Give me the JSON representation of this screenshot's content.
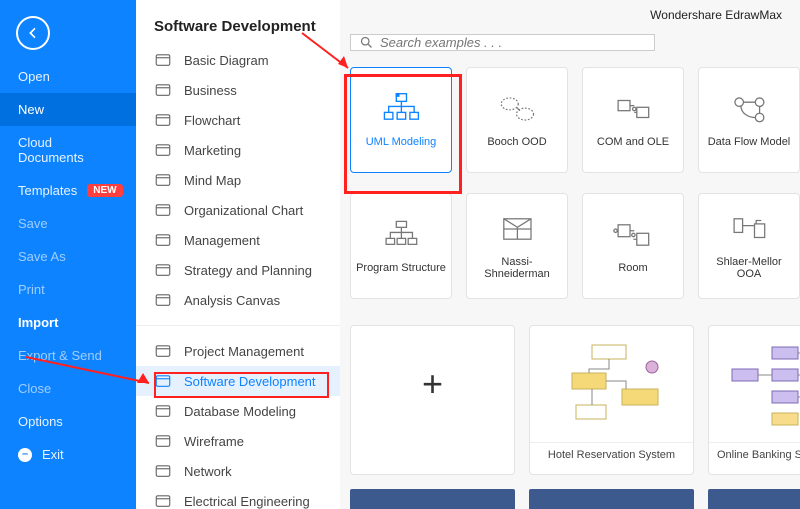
{
  "app_title": "Wondershare EdrawMax",
  "page_title": "Software Development",
  "new_badge": "NEW",
  "sidebar": [
    {
      "label": "Open",
      "kind": "item"
    },
    {
      "label": "New",
      "kind": "selected"
    },
    {
      "label": "Cloud Documents",
      "kind": "item"
    },
    {
      "label": "Templates",
      "kind": "new"
    },
    {
      "label": "Save",
      "kind": "muted"
    },
    {
      "label": "Save As",
      "kind": "muted"
    },
    {
      "label": "Print",
      "kind": "muted"
    },
    {
      "label": "Import",
      "kind": "bold"
    },
    {
      "label": "Export & Send",
      "kind": "muted"
    },
    {
      "label": "Close",
      "kind": "muted"
    },
    {
      "label": "Options",
      "kind": "item"
    },
    {
      "label": "Exit",
      "kind": "exit"
    }
  ],
  "categories_top": [
    "Basic Diagram",
    "Business",
    "Flowchart",
    "Marketing",
    "Mind Map",
    "Organizational Chart",
    "Management",
    "Strategy and Planning",
    "Analysis Canvas"
  ],
  "categories_bottom": [
    "Project Management",
    "Software Development",
    "Database Modeling",
    "Wireframe",
    "Network",
    "Electrical Engineering"
  ],
  "active_category": "Software Development",
  "search_placeholder": "Search examples . . .",
  "templates_row1": [
    "UML Modeling",
    "Booch OOD",
    "COM and OLE",
    "Data Flow Model"
  ],
  "templates_row2": [
    "Program Structure",
    "Nassi-Shneiderman",
    "Room",
    "Shlaer-Mellor OOA"
  ],
  "selected_template": "UML Modeling",
  "gallery": [
    "Hotel Reservation System",
    "Online Banking Sms Customer"
  ]
}
